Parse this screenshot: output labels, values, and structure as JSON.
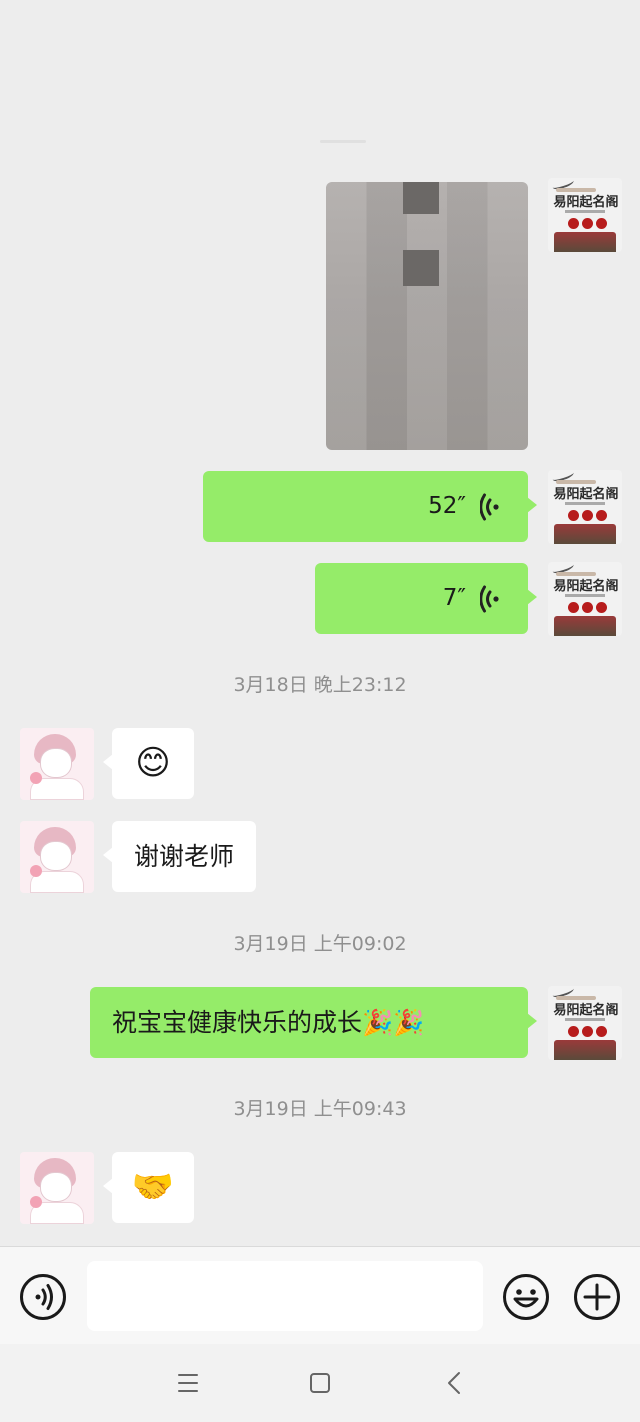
{
  "chat": {
    "messages": [
      {
        "type": "image",
        "sender": "self"
      },
      {
        "type": "voice",
        "sender": "self",
        "duration": "52″"
      },
      {
        "type": "voice",
        "sender": "self",
        "duration": "7″"
      },
      {
        "type": "timestamp",
        "text": "3月18日 晚上23:12"
      },
      {
        "type": "emoji",
        "sender": "other",
        "text": "😊"
      },
      {
        "type": "text",
        "sender": "other",
        "text": "谢谢老师"
      },
      {
        "type": "timestamp",
        "text": "3月19日 上午09:02"
      },
      {
        "type": "text",
        "sender": "self",
        "text": "祝宝宝健康快乐的成长🎉🎉"
      },
      {
        "type": "timestamp",
        "text": "3月19日 上午09:43"
      },
      {
        "type": "emoji",
        "sender": "other",
        "text": "🤝"
      }
    ],
    "self_avatar": {
      "text": "易阳起名阁"
    }
  },
  "input_bar": {
    "left_icon": "voice-input-icon",
    "text_value": "",
    "emoji_icon": "emoji-icon",
    "plus_icon": "plus-icon"
  },
  "nav_bar": {
    "items": [
      "menu-icon",
      "home-icon",
      "back-icon"
    ]
  },
  "colors": {
    "background": "#ededed",
    "outgoing_bubble": "#95ec69",
    "incoming_bubble": "#ffffff",
    "timestamp_text": "#8f8f8f"
  }
}
